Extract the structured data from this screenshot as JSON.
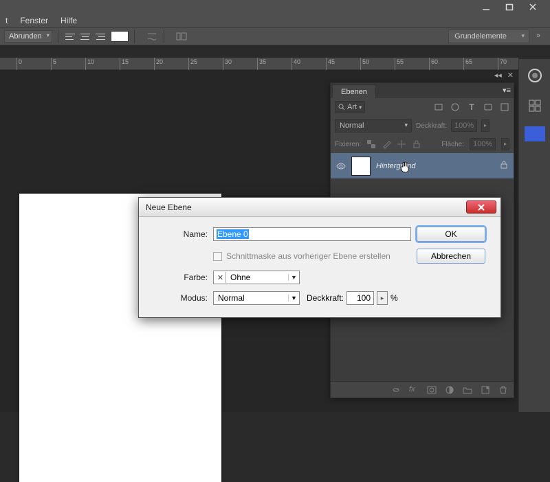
{
  "window_controls": {
    "minimize": "_",
    "maximize": "□",
    "close": "✕"
  },
  "menu": {
    "item1": "t",
    "item2": "Fenster",
    "item3": "Hilfe"
  },
  "options": {
    "rounding_label": "Abrunden",
    "workspace": "Grundelemente"
  },
  "ruler_ticks": [
    "0",
    "5",
    "10",
    "15",
    "20",
    "25",
    "30",
    "35",
    "40",
    "45",
    "50",
    "55",
    "60",
    "65",
    "70"
  ],
  "layers_panel": {
    "tab": "Ebenen",
    "kind_label": "Art",
    "blend_mode": "Normal",
    "opacity_label": "Deckkraft:",
    "opacity_value": "100%",
    "lock_label": "Fixieren:",
    "fill_label": "Fläche:",
    "fill_value": "100%",
    "layer_name": "Hintergrund"
  },
  "dialog": {
    "title": "Neue Ebene",
    "name_label": "Name:",
    "name_value": "Ebene 0",
    "clip_label": "Schnittmaske aus vorheriger Ebene erstellen",
    "color_label": "Farbe:",
    "color_value": "Ohne",
    "mode_label": "Modus:",
    "mode_value": "Normal",
    "opacity_label": "Deckkraft:",
    "opacity_value": "100",
    "percent": "%",
    "ok": "OK",
    "cancel": "Abbrechen"
  }
}
